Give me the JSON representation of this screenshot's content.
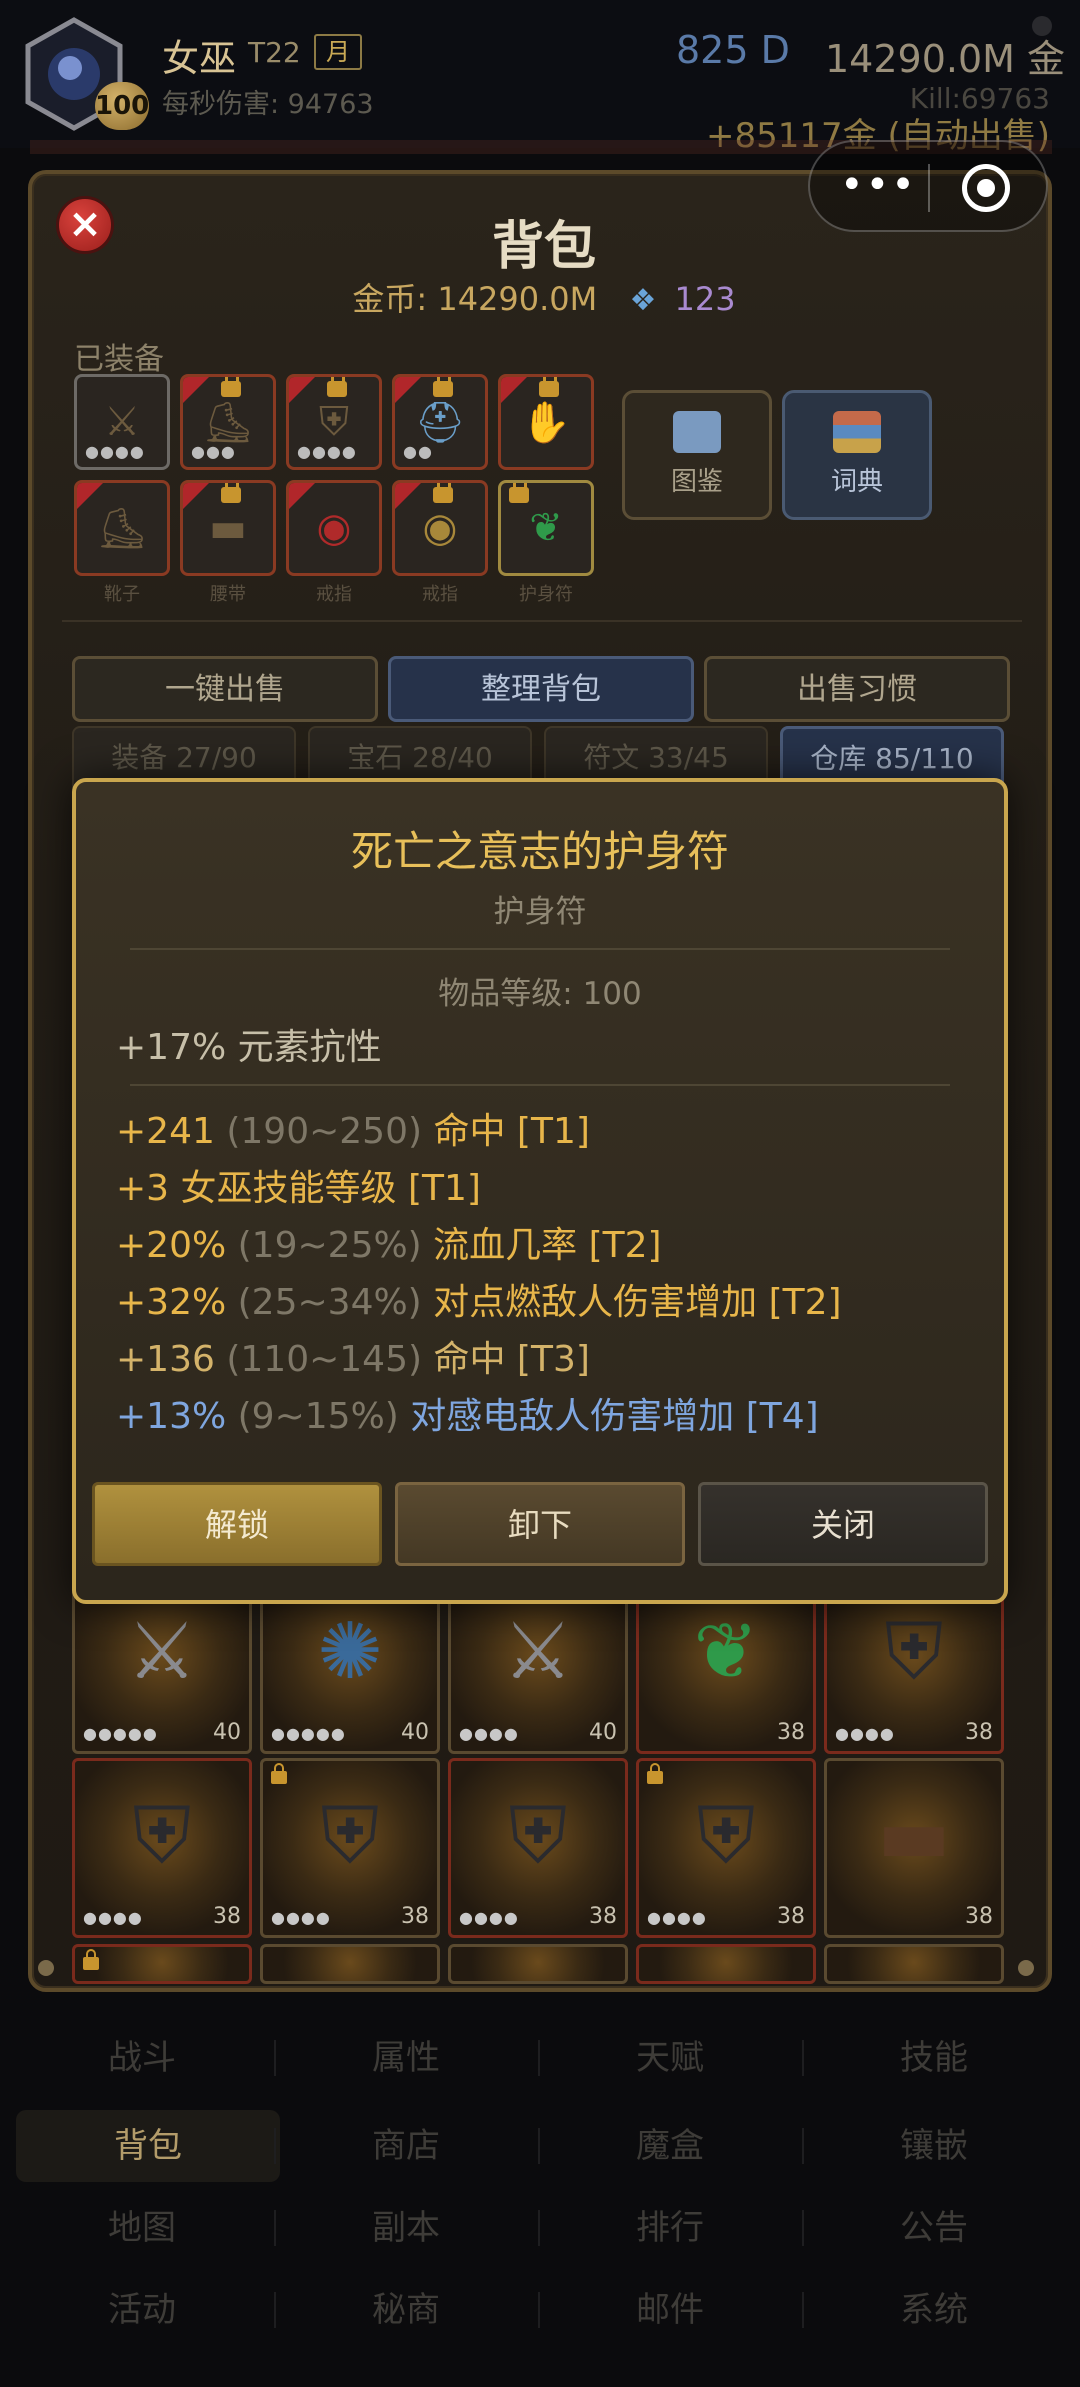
{
  "header": {
    "char_name": "女巫",
    "tier": "T22",
    "month_badge": "月",
    "level": "100",
    "dps": "每秒伤害: 94763",
    "diamond": "825 D",
    "gold": "14290.0M 金",
    "kill": "Kill:69763",
    "auto_sell": "+85117金 (自动出售)"
  },
  "capsule": {
    "more_icon": "•••",
    "target_icon": "record-icon"
  },
  "backpack": {
    "title": "背包",
    "gold_text": "金币: 14290.0M",
    "gem_count": "123",
    "equipped_label": "已装备",
    "equipped_row1": [
      {
        "icon": "sword-icon",
        "glyph": "⚔",
        "dots": "●●●●"
      },
      {
        "icon": "boots-icon",
        "glyph": "⛸",
        "dots": "●●●"
      },
      {
        "icon": "armor-icon",
        "glyph": "⛨",
        "dots": "●●●●"
      },
      {
        "icon": "helmet-icon",
        "glyph": "⛑",
        "dots": "●●"
      },
      {
        "icon": "gloves-icon",
        "glyph": "✋",
        "dots": ""
      }
    ],
    "equipped_row2": [
      {
        "icon": "boots-icon",
        "glyph": "⛸",
        "label": "靴子"
      },
      {
        "icon": "belt-icon",
        "glyph": "▬",
        "label": "腰带"
      },
      {
        "icon": "ring-icon",
        "glyph": "◉",
        "label": "戒指"
      },
      {
        "icon": "ring-icon",
        "glyph": "◉",
        "label": "戒指"
      },
      {
        "icon": "amulet-icon",
        "glyph": "❦",
        "label": "护身符"
      }
    ],
    "codex_label": "图鉴",
    "dictionary_label": "词典",
    "sell_all": "一键出售",
    "sort_bag": "整理背包",
    "sell_habit": "出售习惯",
    "tabs": [
      "装备 27/90",
      "宝石 28/40",
      "符文 33/45",
      "仓库 85/110"
    ],
    "grid_row1": [
      {
        "icon": "sword-icon",
        "glyph": "⚔",
        "level": "40",
        "dots": "●●●●●"
      },
      {
        "icon": "staff-icon",
        "glyph": "✺",
        "level": "40",
        "dots": "●●●●●"
      },
      {
        "icon": "sword-icon",
        "glyph": "⚔",
        "level": "40",
        "dots": "●●●●"
      },
      {
        "icon": "amulet-icon",
        "glyph": "❦",
        "level": "38",
        "dots": ""
      },
      {
        "icon": "armor-icon",
        "glyph": "⛨",
        "level": "38",
        "dots": "●●●●"
      }
    ],
    "grid_row2": [
      {
        "icon": "armor-icon",
        "glyph": "⛨",
        "level": "38",
        "dots": "●●●●"
      },
      {
        "icon": "armor-icon",
        "glyph": "⛨",
        "level": "38",
        "dots": "●●●●"
      },
      {
        "icon": "armor-icon",
        "glyph": "⛨",
        "level": "38",
        "dots": "●●●●"
      },
      {
        "icon": "armor-icon",
        "glyph": "⛨",
        "level": "38",
        "dots": "●●●●"
      },
      {
        "icon": "belt-icon",
        "glyph": "▬",
        "level": "38",
        "dots": ""
      }
    ]
  },
  "tooltip": {
    "item_name": "死亡之意志的护身符",
    "item_type": "护身符",
    "item_level": "物品等级: 100",
    "implicit": "+17% 元素抗性",
    "affixes": [
      {
        "value": "+241",
        "range": "(190~250)",
        "stat": "命中 [T1]",
        "color": "#e8b64a"
      },
      {
        "value": "+3",
        "range": "",
        "stat": "女巫技能等级 [T1]",
        "color": "#e8b64a"
      },
      {
        "value": "+20%",
        "range": "(19~25%)",
        "stat": "流血几率 [T2]",
        "color": "#e8b64a"
      },
      {
        "value": "+32%",
        "range": "(25~34%)",
        "stat": "对点燃敌人伤害增加 [T2]",
        "color": "#e8b64a"
      },
      {
        "value": "+136",
        "range": "(110~145)",
        "stat": "命中 [T3]",
        "color": "#d4b36a"
      },
      {
        "value": "+13%",
        "range": "(9~15%)",
        "stat": "对感电敌人伤害增加 [T4]",
        "color": "#7fa6df"
      }
    ],
    "unlock": "解锁",
    "unequip": "卸下",
    "close": "关闭"
  },
  "nav": {
    "rows": [
      [
        "战斗",
        "属性",
        "天赋",
        "技能"
      ],
      [
        "背包",
        "商店",
        "魔盒",
        "镶嵌"
      ],
      [
        "地图",
        "副本",
        "排行",
        "公告"
      ],
      [
        "活动",
        "秘商",
        "邮件",
        "系统"
      ]
    ],
    "active": "背包"
  }
}
